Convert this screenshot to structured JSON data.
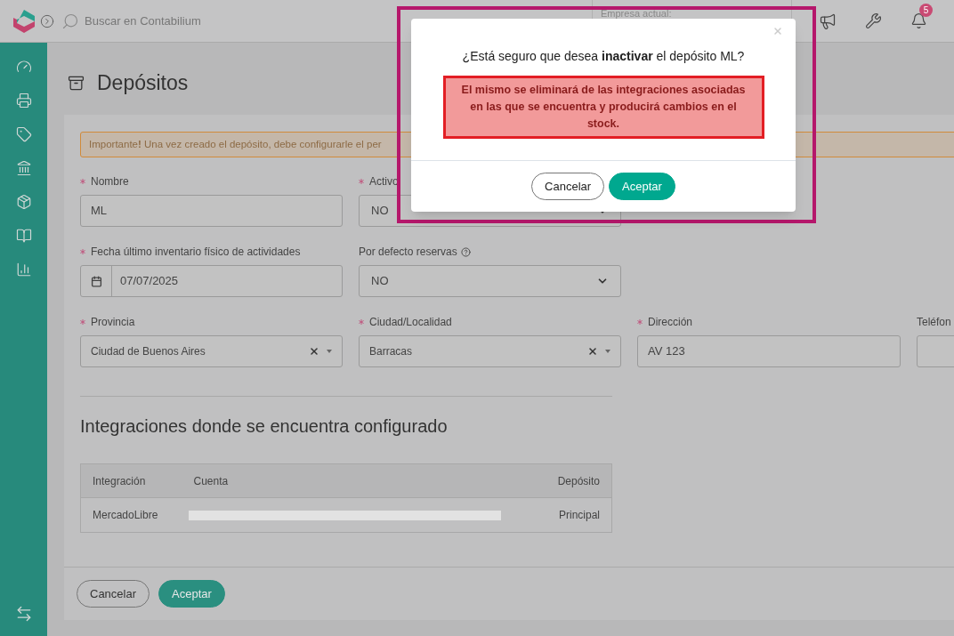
{
  "header": {
    "search": {
      "placeholder": "Buscar en Contabilium"
    },
    "company": {
      "label": "Empresa actual:"
    },
    "notifications": {
      "count": "5"
    }
  },
  "page": {
    "title": "Depósitos"
  },
  "notice": "Importante**!** Una vez creado el depósito, debe configurarle el per",
  "rows": [
    [
      {
        "label": "Nombre",
        "required": true,
        "kind": "text",
        "value": "ML"
      },
      {
        "label": "Activo",
        "required": true,
        "kind": "select",
        "value": "NO"
      }
    ],
    [
      {
        "label": "Fecha último inventario físico de actividades",
        "required": true,
        "kind": "date",
        "value": "07/07/2025"
      },
      {
        "label": "Por defecto reservas",
        "required": false,
        "help": true,
        "kind": "select",
        "value": "NO"
      }
    ],
    [
      {
        "label": "Provincia",
        "required": true,
        "kind": "combo",
        "value": "Ciudad de Buenos Aires"
      },
      {
        "label": "Ciudad/Localidad",
        "required": true,
        "kind": "combo",
        "value": "Barracas"
      },
      {
        "label": "Dirección",
        "required": true,
        "kind": "text",
        "value": "AV 123"
      },
      {
        "label": "Teléfon",
        "required": false,
        "kind": "text"
      }
    ]
  ],
  "integrations": {
    "title": "Integraciones donde se encuentra configurado",
    "columns": [
      "Integración",
      "Cuenta",
      "Depósito"
    ],
    "rows": [
      {
        "integration": "MercadoLibre",
        "account_redacted": true,
        "deposit": "Principal"
      }
    ]
  },
  "footer_buttons": [
    {
      "label": "Cancelar",
      "kind": "secondary"
    },
    {
      "label": "Aceptar",
      "kind": "primary"
    }
  ],
  "dialog": {
    "highlighted": true,
    "question": "¿Está seguro que desea **inactivar** el depósito ML?",
    "warning": "El mismo se eliminará de las integraciones asociadas en las que se encuentra y producirá cambios en el stock.",
    "buttons": [
      {
        "label": "Cancelar",
        "kind": "secondary"
      },
      {
        "label": "Aceptar",
        "kind": "primary"
      }
    ]
  }
}
